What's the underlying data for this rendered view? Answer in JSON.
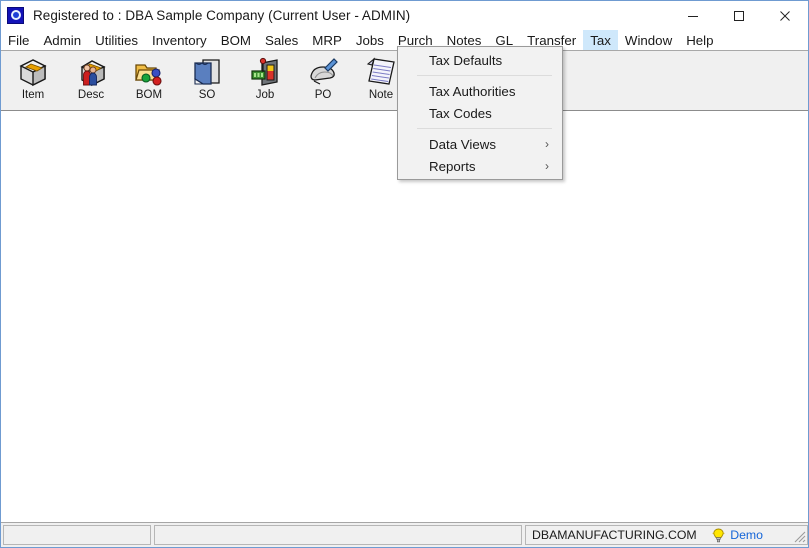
{
  "window": {
    "title": "Registered to : DBA Sample Company (Current User - ADMIN)",
    "app_icon": "dba-app-icon",
    "controls": {
      "minimize": "minimize-button",
      "maximize": "maximize-button",
      "close": "close-button"
    }
  },
  "menu_bar": {
    "items": [
      {
        "label": "File",
        "active": false
      },
      {
        "label": "Admin",
        "active": false
      },
      {
        "label": "Utilities",
        "active": false
      },
      {
        "label": "Inventory",
        "active": false
      },
      {
        "label": "BOM",
        "active": false
      },
      {
        "label": "Sales",
        "active": false
      },
      {
        "label": "MRP",
        "active": false
      },
      {
        "label": "Jobs",
        "active": false
      },
      {
        "label": "Purch",
        "active": false
      },
      {
        "label": "Notes",
        "active": false
      },
      {
        "label": "GL",
        "active": false
      },
      {
        "label": "Transfer",
        "active": false
      },
      {
        "label": "Tax",
        "active": true
      },
      {
        "label": "Window",
        "active": false
      },
      {
        "label": "Help",
        "active": false
      }
    ],
    "active_menu": "Tax",
    "highlight_color": "#cfe8fb"
  },
  "tax_dropdown": {
    "open": true,
    "items": [
      {
        "label": "Tax Defaults",
        "submenu": false
      },
      {
        "separator": true
      },
      {
        "label": "Tax Authorities",
        "submenu": false
      },
      {
        "label": "Tax Codes",
        "submenu": false
      },
      {
        "separator": true
      },
      {
        "label": "Data Views",
        "submenu": true
      },
      {
        "label": "Reports",
        "submenu": true
      }
    ],
    "submenu_arrow": "chevron-right-icon"
  },
  "toolbar": {
    "buttons": [
      {
        "label": "Item",
        "icon": "item-box-icon"
      },
      {
        "label": "Desc",
        "icon": "descriptor-people-box-icon"
      },
      {
        "label": "BOM",
        "icon": "bom-folder-icon"
      },
      {
        "label": "SO",
        "icon": "sales-order-icon"
      },
      {
        "label": "Job",
        "icon": "job-icon"
      },
      {
        "label": "PO",
        "icon": "purchase-order-icon"
      },
      {
        "label": "Note",
        "icon": "note-pad-icon"
      }
    ]
  },
  "status_bar": {
    "panel_1": "",
    "panel_2": "",
    "website": "DBAMANUFACTURING.COM",
    "demo_label": "Demo",
    "demo_icon": "lightbulb-icon",
    "demo_color": "#1565d8",
    "resize_grip": "resize-grip-icon"
  }
}
